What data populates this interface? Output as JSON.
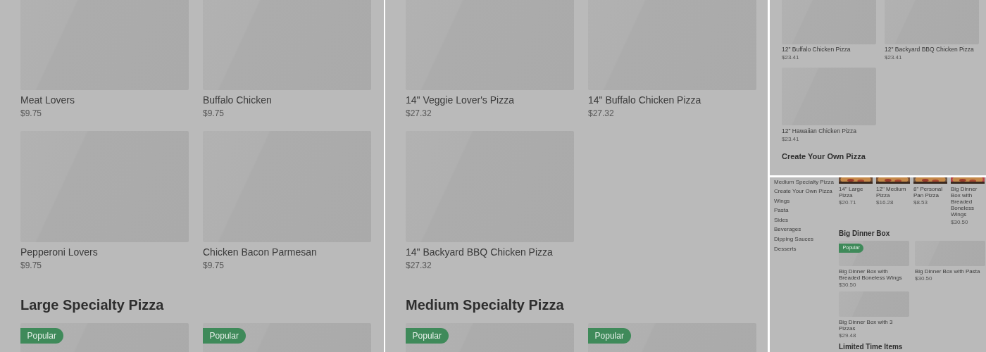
{
  "panels": [
    {
      "kind": "large",
      "sections": [
        {
          "items": [
            {
              "name": "Meat Lovers",
              "price": "$9.75"
            },
            {
              "name": "Buffalo Chicken",
              "price": "$9.75"
            },
            {
              "name": "Pepperoni Lovers",
              "price": "$9.75"
            },
            {
              "name": "Chicken Bacon Parmesan",
              "price": "$9.75"
            }
          ]
        },
        {
          "heading": "Large Specialty Pizza",
          "items": [
            {
              "badge": "Popular"
            },
            {
              "badge": "Popular"
            }
          ]
        }
      ]
    },
    {
      "kind": "large",
      "sections": [
        {
          "items": [
            {
              "name": "14\" Veggie Lover's Pizza",
              "price": "$27.32"
            },
            {
              "name": "14\" Buffalo Chicken Pizza",
              "price": "$27.32"
            },
            {
              "name": "14\" Backyard BBQ Chicken Pizza",
              "price": "$27.32"
            }
          ]
        },
        {
          "heading": "Medium Specialty Pizza",
          "items": [
            {
              "badge": "Popular"
            },
            {
              "badge": "Popular"
            }
          ]
        }
      ]
    },
    {
      "kind": "small",
      "sections": [
        {
          "items": [
            {
              "name": "12\" Buffalo Chicken Pizza",
              "price": "$23.41"
            },
            {
              "name": "12\" Backyard BBQ Chicken Pizza",
              "price": "$23.41"
            },
            {
              "name": "12\" Hawaiian Chicken Pizza",
              "price": "$23.41"
            }
          ]
        },
        {
          "heading": "Create Your Own Pizza"
        }
      ]
    },
    {
      "kind": "tiny",
      "sidebar": [
        "Medium Specialty Pizza",
        "Create Your Own Pizza",
        "Wings",
        "Pasta",
        "Sides",
        "Beverages",
        "Dipping Sauces",
        "Desserts"
      ],
      "sections": [
        {
          "kind": "strip",
          "items": [
            {
              "name": "14\" Large Pizza",
              "price": "$20.71",
              "kind": "picture"
            },
            {
              "name": "12\" Medium Pizza",
              "price": "$16.28",
              "kind": "picture"
            },
            {
              "name": "8\" Personal Pan Pizza",
              "price": "$8.53",
              "kind": "picture"
            },
            {
              "name": "Big Dinner Box with Breaded Boneless Wings",
              "price": "$30.50",
              "kind": "picture"
            }
          ]
        },
        {
          "heading": "Big Dinner Box",
          "items": [
            {
              "badge": "Popular",
              "name": "Big Dinner Box with Breaded Boneless Wings",
              "price": "$30.50"
            },
            {
              "name": "Big Dinner Box with Pasta",
              "price": "$30.50"
            },
            {
              "name": "Big Dinner Box with 3 Pizzas",
              "price": "$29.48"
            }
          ]
        },
        {
          "heading": "Limited Time Items"
        }
      ]
    }
  ]
}
